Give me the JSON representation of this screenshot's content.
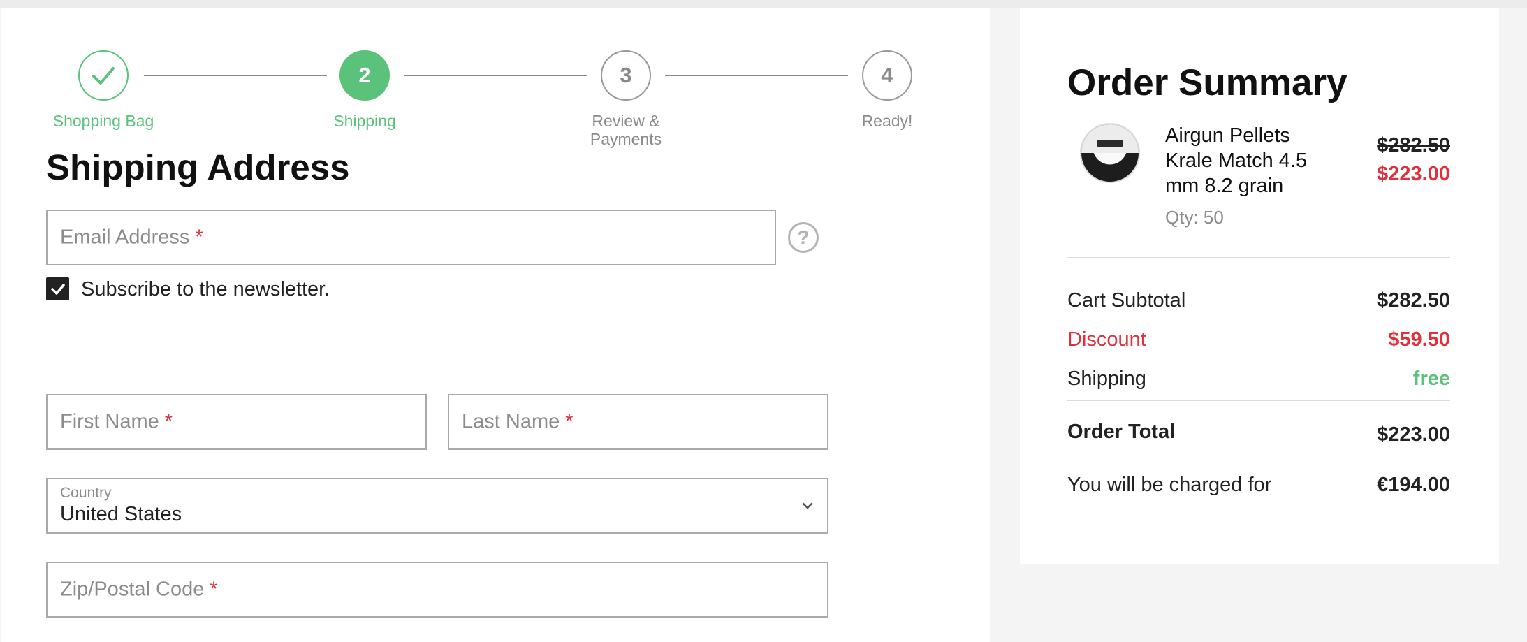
{
  "stepper": {
    "steps": [
      {
        "label": "Shopping Bag",
        "number": "",
        "state": "done"
      },
      {
        "label": "Shipping",
        "number": "2",
        "state": "active"
      },
      {
        "label": "Review & Payments",
        "number": "3",
        "state": "pending"
      },
      {
        "label": "Ready!",
        "number": "4",
        "state": "pending"
      }
    ]
  },
  "shipping": {
    "title": "Shipping Address",
    "email_placeholder": "Email Address",
    "required_mark": "*",
    "subscribe_label": "Subscribe to the newsletter.",
    "subscribe_checked": true,
    "first_name_placeholder": "First Name",
    "last_name_placeholder": "Last Name",
    "country_label": "Country",
    "country_value": "United States",
    "zip_placeholder": "Zip/Postal Code",
    "help_symbol": "?"
  },
  "summary": {
    "title": "Order Summary",
    "product": {
      "name": "Airgun Pellets Krale Match 4.5 mm 8.2 grain",
      "qty": "Qty: 50",
      "old_price": "$282.50",
      "new_price": "$223.00"
    },
    "subtotal_label": "Cart Subtotal",
    "subtotal_value": "$282.50",
    "discount_label": "Discount",
    "discount_value": "$59.50",
    "shipping_label": "Shipping",
    "shipping_value": "free",
    "total_label": "Order Total",
    "total_value": "$223.00",
    "charged_label": "You will be charged for",
    "charged_value": "€194.00"
  },
  "colors": {
    "accent_green": "#5ac27a",
    "required_red": "#e0303c"
  },
  "icons": [
    "check-icon",
    "question-mark-icon",
    "checkbox-check-icon",
    "chevron-down-icon"
  ]
}
